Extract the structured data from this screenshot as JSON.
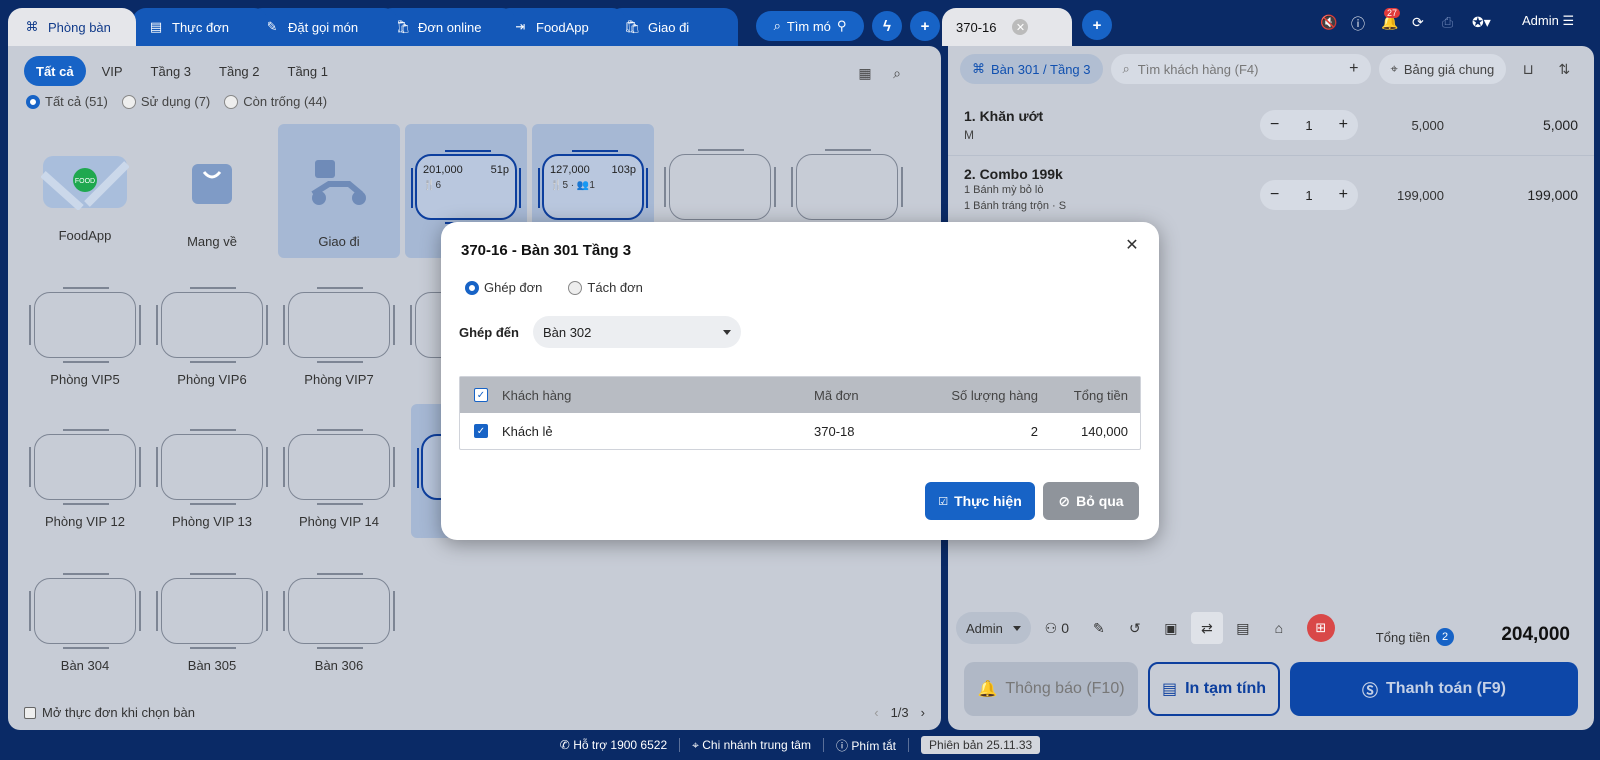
{
  "top_tabs": [
    {
      "label": "Phòng bàn",
      "icon": "table-icon",
      "active": true
    },
    {
      "label": "Thực đơn",
      "icon": "menu-icon"
    },
    {
      "label": "Đặt gọi món",
      "icon": "order-icon"
    },
    {
      "label": "Đơn online",
      "icon": "bag-icon"
    },
    {
      "label": "FoodApp",
      "icon": "login-icon"
    },
    {
      "label": "Giao đi",
      "icon": "bag-icon"
    }
  ],
  "search_dish_label": "Tìm mó",
  "left": {
    "filters": [
      "Tất cả",
      "VIP",
      "Tầng 3",
      "Tầng 2",
      "Tầng 1"
    ],
    "radios": [
      "Tất cả (51)",
      "Sử dụng (7)",
      "Còn trống (44)"
    ],
    "tiles": {
      "foodapp": "FoodApp",
      "takeaway": "Mang về",
      "delivery": "Giao đi",
      "busy1_amount": "201,000",
      "busy1_duration": "51p",
      "busy1_info": "🍴6",
      "busy2_amount": "127,000",
      "busy2_duration": "103p",
      "busy2_info": "🍴5 · 👥1",
      "vip5": "Phòng VIP5",
      "vip6": "Phòng VIP6",
      "vip7": "Phòng VIP7",
      "vip12": "Phòng VIP 12",
      "vip13": "Phòng VIP 13",
      "vip14": "Phòng VIP 14",
      "b304": "Bàn 304",
      "b305": "Bàn 305",
      "b306": "Bàn 306"
    },
    "open_menu_label": "Mở thực đơn khi chọn bàn",
    "page": "1/3"
  },
  "right": {
    "tab_label": "370-16",
    "admin": "Admin",
    "notif_count": "27",
    "table_sel": "Bàn 301 / Tầng 3",
    "customer_search_placeholder": "Tìm khách hàng (F4)",
    "pricebook": "Bảng giá chung",
    "items": [
      {
        "name": "1. Khăn ướt",
        "sub1": "M",
        "sub2": "",
        "qty": "1",
        "price": "5,000",
        "total": "5,000"
      },
      {
        "name": "2. Combo 199k",
        "sub1": "1 Bánh mỳ bỏ lò",
        "sub2": "1 Bánh tráng trộn ·  S",
        "qty": "1",
        "price": "199,000",
        "total": "199,000"
      }
    ],
    "footer_user": "Admin",
    "guest_count": "0",
    "grand_label": "Tổng tiền",
    "grand_count": "2",
    "grand_total": "204,000",
    "btn_notify": "Thông báo (F10)",
    "btn_print": "In tạm tính",
    "btn_pay": "Thanh toán (F9)"
  },
  "status": {
    "support": "Hỗ trợ 1900 6522",
    "branch": "Chi nhánh trung tâm",
    "shortcuts": "Phím tắt",
    "version": "Phiên bản 25.11.33"
  },
  "modal": {
    "title": "370-16 - Bàn 301 Tầng 3",
    "mode_merge": "Ghép đơn",
    "mode_split": "Tách đơn",
    "merge_to_label": "Ghép đến",
    "merge_to_value": "Bàn 302",
    "headers": {
      "customer": "Khách hàng",
      "code": "Mã đơn",
      "qty": "Số lượng hàng",
      "total": "Tổng tiền"
    },
    "rows": [
      {
        "customer": "Khách lẻ",
        "code": "370-18",
        "qty": "2",
        "total": "140,000"
      }
    ],
    "btn_ok": "Thực hiện",
    "btn_cancel": "Bỏ qua"
  }
}
